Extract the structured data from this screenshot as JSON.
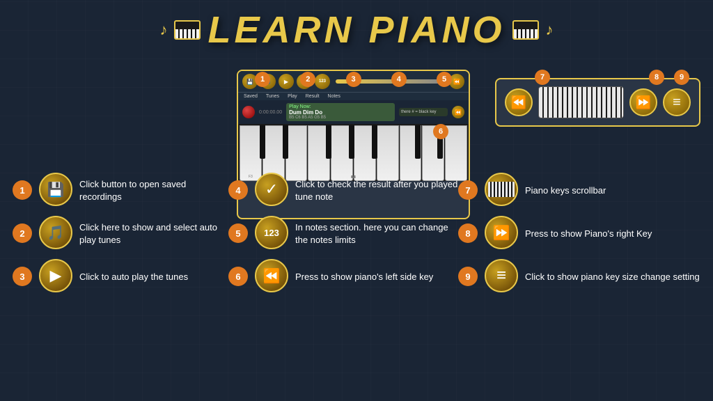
{
  "title": {
    "text": "LEARN PIANO",
    "note_left": "♪♫",
    "note_right": "♫♪"
  },
  "toolbar_annotations": [
    "1",
    "2",
    "3",
    "4",
    "5"
  ],
  "preview": {
    "buttons": [
      "Saved",
      "Tunes",
      "Play",
      "Result",
      "Notes"
    ],
    "play_now": "Play Now:",
    "song_name": "Dum Dim Do",
    "time": "0:00:00.00",
    "notes_label": "B5 C6 B5 A5 G5 B5",
    "side_note": "there # = black key"
  },
  "right_panel": {
    "badge_6": "6",
    "badge_7": "7",
    "badge_8": "8",
    "badge_9": "9"
  },
  "legend": {
    "col1": [
      {
        "num": "1",
        "icon": "💾",
        "text": "Click button to open saved recordings"
      },
      {
        "num": "2",
        "icon": "🎵",
        "text": "Click here to show and select  auto play tunes"
      },
      {
        "num": "3",
        "icon": "▶",
        "text": "Click to auto play the tunes"
      }
    ],
    "col2": [
      {
        "num": "4",
        "icon": "✓",
        "text": "Click to check the result after you played tune note"
      },
      {
        "num": "5",
        "icon": "123",
        "text": "In notes section. here you can change the notes limits"
      },
      {
        "num": "6",
        "icon": "⏮",
        "text": "Press to show piano's left side key"
      }
    ],
    "col3": [
      {
        "num": "7",
        "icon": "🎹",
        "text": "Piano keys scrollbar"
      },
      {
        "num": "8",
        "icon": "⏭",
        "text": "Press to show Piano's right Key"
      },
      {
        "num": "9",
        "icon": "≡",
        "text": "Click to show  piano key size change setting"
      }
    ]
  }
}
